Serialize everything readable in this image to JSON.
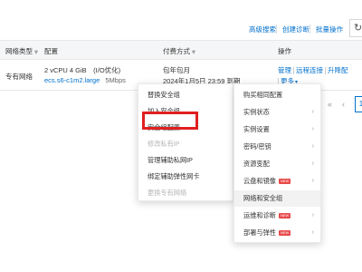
{
  "toolbar": {
    "advanced_search": "高级搜索",
    "create_diagnosis": "创建诊断",
    "batch_operation": "批量操作",
    "refresh_icon": "refresh-icon"
  },
  "table": {
    "headers": {
      "network_type": "网络类型",
      "config": "配置",
      "billing": "付费方式",
      "actions": "操作"
    },
    "row": {
      "network_type": "专有网络",
      "config_spec": "2 vCPU 4 GiB　(I/O优化)",
      "instance_type": "ecs.s6-c1m2.large",
      "bandwidth": "5Mbps",
      "billing_type": "包年包月",
      "expire": "2024年1月5日 23:59 到期",
      "action_manage": "管理",
      "action_remote": "远程连接",
      "action_upgrade": "升降配",
      "action_more": "更多"
    }
  },
  "pagination": {
    "first": "«",
    "prev": "‹",
    "current": "1"
  },
  "submenu": {
    "items": [
      {
        "label": "替换安全组",
        "disabled": false
      },
      {
        "label": "加入安全组",
        "disabled": false
      },
      {
        "label": "安全组配置",
        "disabled": false
      },
      {
        "label": "修改私有IP",
        "disabled": true
      },
      {
        "label": "管理辅助私网IP",
        "disabled": false
      },
      {
        "label": "绑定辅助弹性网卡",
        "disabled": false
      },
      {
        "label": "更换专有网络",
        "disabled": true
      }
    ]
  },
  "more_menu": {
    "items": [
      {
        "label": "购买相同配置",
        "arrow": false,
        "new": false
      },
      {
        "label": "实例状态",
        "arrow": true,
        "new": false
      },
      {
        "label": "实例设置",
        "arrow": true,
        "new": false
      },
      {
        "label": "密码/密钥",
        "arrow": true,
        "new": false
      },
      {
        "label": "资源变配",
        "arrow": true,
        "new": false
      },
      {
        "label": "云盘和镜像",
        "arrow": true,
        "new": true
      },
      {
        "label": "网络和安全组",
        "arrow": false,
        "new": false
      },
      {
        "label": "运维和诊断",
        "arrow": true,
        "new": true
      },
      {
        "label": "部署与弹性",
        "arrow": true,
        "new": true
      }
    ],
    "new_badge": "NEW"
  },
  "colors": {
    "link": "#0070cc",
    "highlight": "#e02020",
    "badge": "#e84a4a"
  }
}
